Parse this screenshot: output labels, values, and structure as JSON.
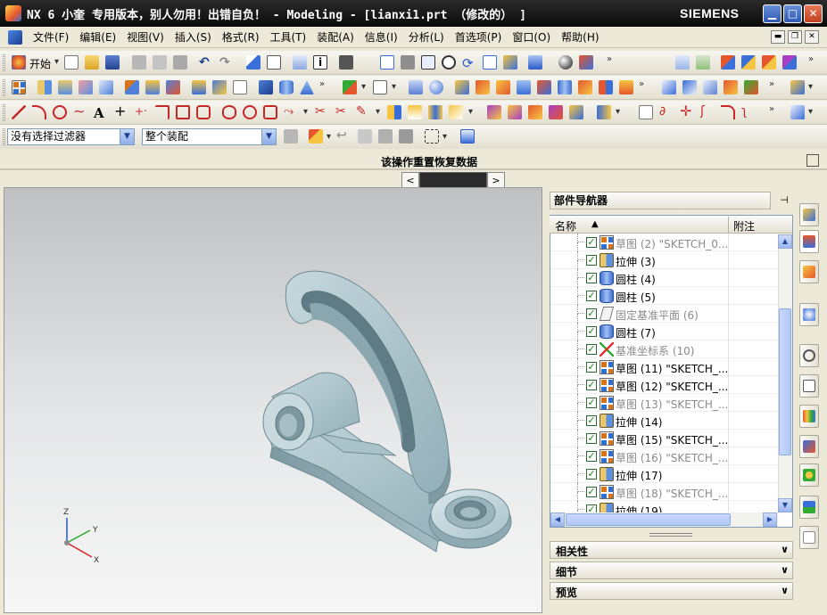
{
  "window": {
    "title": "NX 6  小奎 专用版本，别人勿用！出错自负！ - Modeling - [lianxi1.prt （修改的） ]",
    "brand": "SIEMENS",
    "min_glyph": "▁",
    "max_glyph": "□",
    "close_glyph": "✕"
  },
  "menu": {
    "items": [
      "文件(F)",
      "编辑(E)",
      "视图(V)",
      "插入(S)",
      "格式(R)",
      "工具(T)",
      "装配(A)",
      "信息(I)",
      "分析(L)",
      "首选项(P)",
      "窗口(O)",
      "帮助(H)"
    ],
    "doc_min": "▬",
    "doc_restore": "❐",
    "doc_close": "✕"
  },
  "toolbar": {
    "start_label": "开始",
    "layer_value": "1"
  },
  "filter": {
    "selection_filter": "没有选择过滤器",
    "scope": "整个装配"
  },
  "status": {
    "message": "该操作重置恢复数据"
  },
  "navigator": {
    "title": "部件导航器",
    "pin_glyph": "⊣",
    "col_name": "名称",
    "sort_glyph": "▲",
    "col_note": "附注",
    "rows": [
      {
        "label": "草图 (2) \"SKETCH_0...",
        "type": "sketch",
        "dim": true
      },
      {
        "label": "拉伸 (3)",
        "type": "extrude",
        "dim": false
      },
      {
        "label": "圆柱 (4)",
        "type": "cylinder",
        "dim": false
      },
      {
        "label": "圆柱 (5)",
        "type": "cylinder",
        "dim": false
      },
      {
        "label": "固定基准平面 (6)",
        "type": "plane",
        "dim": true
      },
      {
        "label": "圆柱 (7)",
        "type": "cylinder",
        "dim": false
      },
      {
        "label": "基准坐标系 (10)",
        "type": "csys",
        "dim": true
      },
      {
        "label": "草图 (11) \"SKETCH_...",
        "type": "sketch",
        "dim": false
      },
      {
        "label": "草图 (12) \"SKETCH_...",
        "type": "sketch",
        "dim": false
      },
      {
        "label": "草图 (13) \"SKETCH_...",
        "type": "sketch",
        "dim": true
      },
      {
        "label": "拉伸 (14)",
        "type": "extrude",
        "dim": false
      },
      {
        "label": "草图 (15) \"SKETCH_...",
        "type": "sketch",
        "dim": false
      },
      {
        "label": "草图 (16) \"SKETCH_...",
        "type": "sketch",
        "dim": true
      },
      {
        "label": "拉伸 (17)",
        "type": "extrude",
        "dim": false
      },
      {
        "label": "草图 (18) \"SKETCH_...",
        "type": "sketch",
        "dim": true
      },
      {
        "label": "拉伸 (19)",
        "type": "extrude",
        "dim": false
      }
    ],
    "sections": [
      "相关性",
      "细节",
      "预览"
    ],
    "check_glyph": "✓",
    "chevron_glyph": "∨"
  },
  "triad": {
    "x": "X",
    "y": "Y",
    "z": "Z"
  },
  "colors": {
    "titlebar": "#0a0a0a",
    "model_body": "#b9cfd6",
    "model_shadow": "#6f8b94",
    "accent": "#2f6fd1"
  }
}
